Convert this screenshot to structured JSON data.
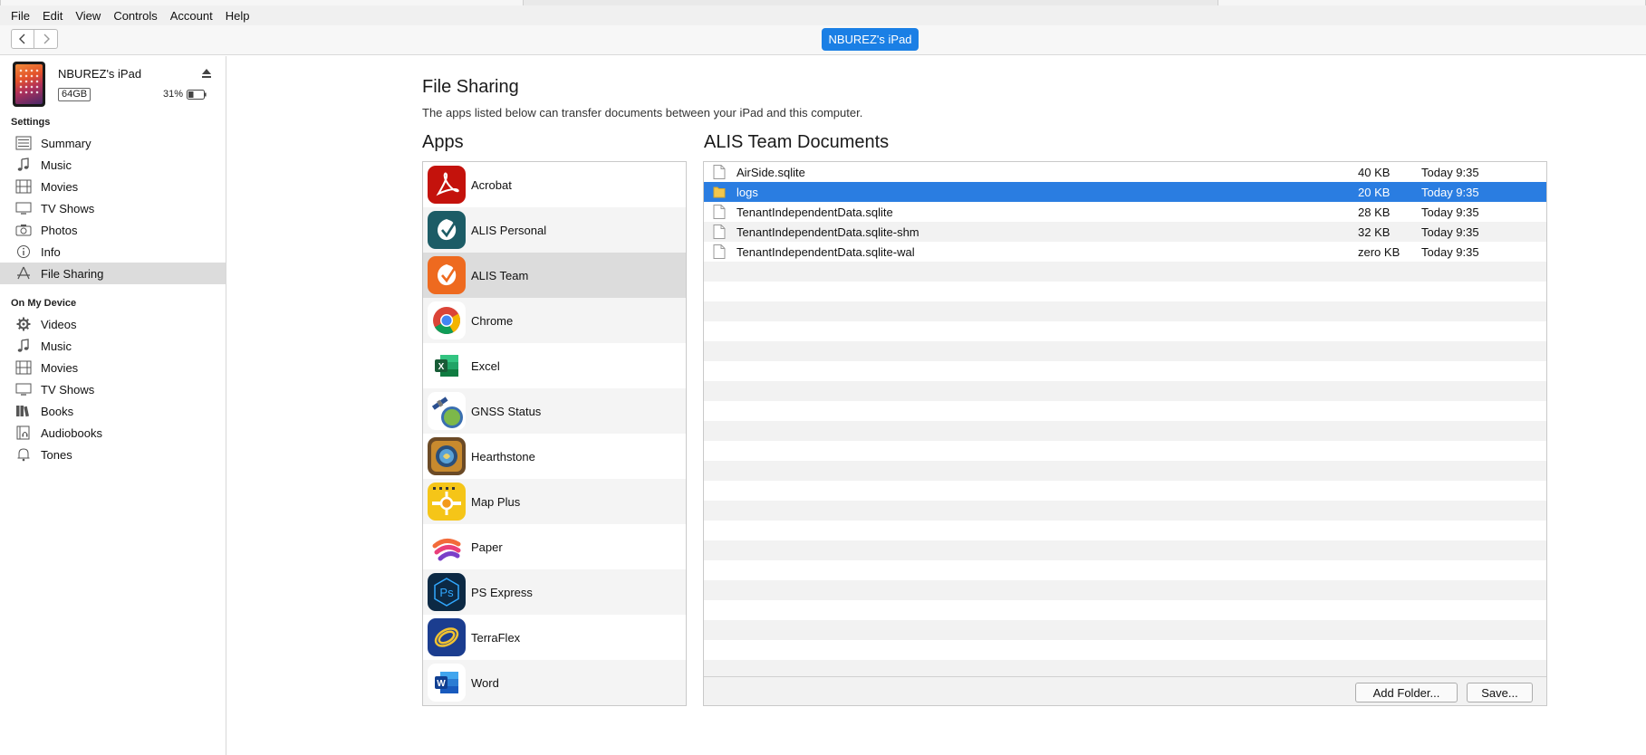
{
  "menubar": {
    "items": [
      "File",
      "Edit",
      "View",
      "Controls",
      "Account",
      "Help"
    ]
  },
  "toolbar": {
    "back_icon": "chevron-left-icon",
    "forward_icon": "chevron-right-icon",
    "device_button": "NBUREZ's iPad"
  },
  "device": {
    "name": "NBUREZ's iPad",
    "capacity": "64GB",
    "battery": "31%"
  },
  "sidebar": {
    "settings_title": "Settings",
    "settings_items": [
      {
        "label": "Summary",
        "icon": "list-icon"
      },
      {
        "label": "Music",
        "icon": "music-note-icon"
      },
      {
        "label": "Movies",
        "icon": "film-icon"
      },
      {
        "label": "TV Shows",
        "icon": "tv-icon"
      },
      {
        "label": "Photos",
        "icon": "camera-icon"
      },
      {
        "label": "Info",
        "icon": "info-icon"
      },
      {
        "label": "File Sharing",
        "icon": "app-store-icon",
        "active": true
      }
    ],
    "device_title": "On My Device",
    "device_items": [
      {
        "label": "Videos",
        "icon": "gear-icon"
      },
      {
        "label": "Music",
        "icon": "music-note-icon"
      },
      {
        "label": "Movies",
        "icon": "film-icon"
      },
      {
        "label": "TV Shows",
        "icon": "tv-icon"
      },
      {
        "label": "Books",
        "icon": "book-icon"
      },
      {
        "label": "Audiobooks",
        "icon": "audiobook-icon"
      },
      {
        "label": "Tones",
        "icon": "bell-icon"
      }
    ]
  },
  "main": {
    "title": "File Sharing",
    "description": "The apps listed below can transfer documents between your iPad and this computer.",
    "apps_title": "Apps",
    "docs_title": "ALIS Team Documents",
    "apps": [
      {
        "name": "Acrobat",
        "icon": "acrobat-icon",
        "color": "#c4120c"
      },
      {
        "name": "ALIS Personal",
        "icon": "alis-personal-icon",
        "color": "#1c5c66"
      },
      {
        "name": "ALIS Team",
        "icon": "alis-team-icon",
        "color": "#ee6a1f",
        "selected": true
      },
      {
        "name": "Chrome",
        "icon": "chrome-icon"
      },
      {
        "name": "Excel",
        "icon": "excel-icon",
        "color": "#1d7044"
      },
      {
        "name": "GNSS Status",
        "icon": "gnss-status-icon"
      },
      {
        "name": "Hearthstone",
        "icon": "hearthstone-icon"
      },
      {
        "name": "Map Plus",
        "icon": "map-plus-icon",
        "color": "#f5c518"
      },
      {
        "name": "Paper",
        "icon": "paper-icon"
      },
      {
        "name": "PS Express",
        "icon": "ps-express-icon",
        "color": "#0c2944"
      },
      {
        "name": "TerraFlex",
        "icon": "terraflex-icon",
        "color": "#1b3d8f"
      },
      {
        "name": "Word",
        "icon": "word-icon",
        "color": "#2b5bb8"
      }
    ],
    "documents": [
      {
        "name": "AirSide.sqlite",
        "size": "40 KB",
        "date": "Today 9:35",
        "type": "file"
      },
      {
        "name": "logs",
        "size": "20 KB",
        "date": "Today 9:35",
        "type": "folder",
        "selected": true
      },
      {
        "name": "TenantIndependentData.sqlite",
        "size": "28 KB",
        "date": "Today 9:35",
        "type": "file"
      },
      {
        "name": "TenantIndependentData.sqlite-shm",
        "size": "32 KB",
        "date": "Today 9:35",
        "type": "file"
      },
      {
        "name": "TenantIndependentData.sqlite-wal",
        "size": "zero KB",
        "date": "Today 9:35",
        "type": "file"
      }
    ],
    "add_folder_button": "Add Folder...",
    "save_button": "Save..."
  }
}
